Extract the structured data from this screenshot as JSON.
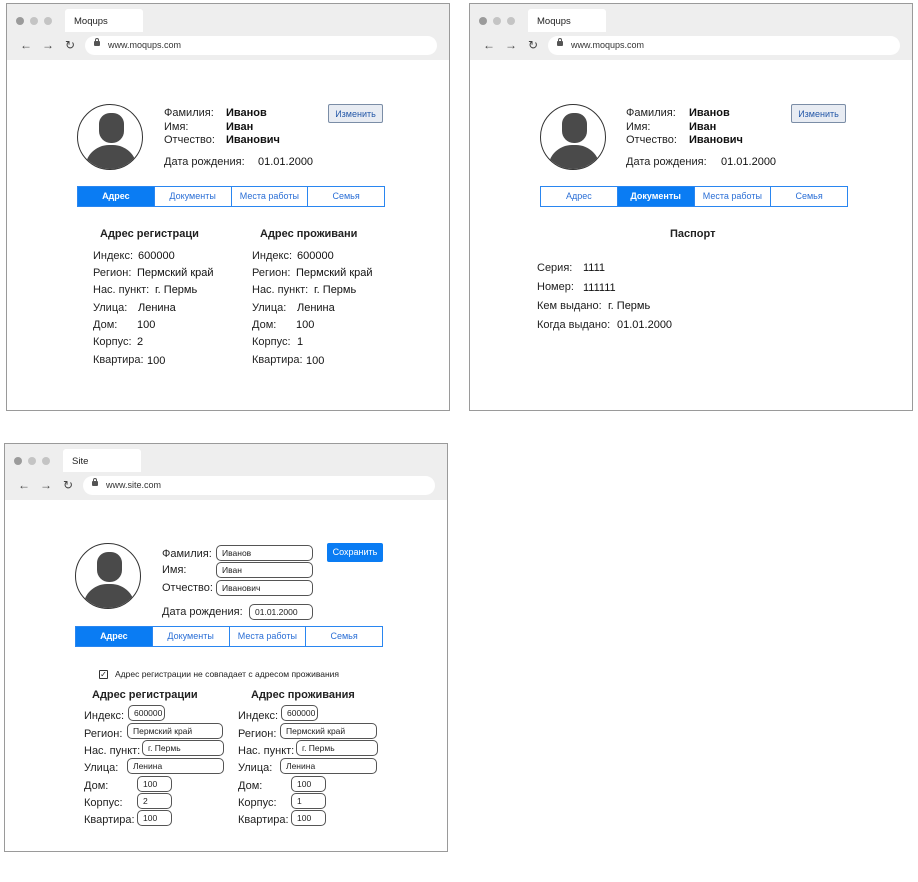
{
  "windows": [
    {
      "tab_title": "Moqups",
      "url": "www.moqups.com"
    },
    {
      "tab_title": "Moqups",
      "url": "www.moqups.com"
    },
    {
      "tab_title": "Site",
      "url": "www.site.com"
    }
  ],
  "nav": {
    "back": "←",
    "forward": "→",
    "reload": "↻"
  },
  "profile": {
    "surname_label": "Фамилия:",
    "surname": "Иванов",
    "name_label": "Имя:",
    "name": "Иван",
    "patronymic_label": "Отчество:",
    "patronymic": "Иванович",
    "birth_label": "Дата рождения:",
    "birth": "01.01.2000"
  },
  "buttons": {
    "edit": "Изменить",
    "save": "Сохранить"
  },
  "tabs": [
    "Адрес",
    "Документы",
    "Места работы",
    "Семья"
  ],
  "address": {
    "reg_title_cut": "Адрес регистраци",
    "live_title_cut": "Адрес проживани",
    "reg_title": "Адрес регистрации",
    "live_title": "Адрес проживания",
    "labels": {
      "index": "Индекс:",
      "region": "Регион:",
      "locality": "Нас. пункт:",
      "street": "Улица:",
      "house": "Дом:",
      "building": "Корпус:",
      "flat": "Квартира:"
    },
    "registration": {
      "index": "600000",
      "region": "Пермский край",
      "locality": "г. Пермь",
      "street": "Ленина",
      "house": "100",
      "building": "2",
      "flat": "100"
    },
    "residence": {
      "index": "600000",
      "region": "Пермский край",
      "locality": "г. Пермь",
      "street": "Ленина",
      "house": "100",
      "building": "1",
      "flat": "100"
    },
    "checkbox_label": "Адрес регистрации не совпадает с адресом проживания",
    "checkbox_mark": "✓"
  },
  "passport": {
    "title": "Паспорт",
    "series_label": "Серия:",
    "series": "1111",
    "number_label": "Номер:",
    "number": "111111",
    "issued_by_label": "Кем выдано:",
    "issued_by": "г. Пермь",
    "issued_date_label": "Когда выдано:",
    "issued_date": "01.01.2000"
  },
  "colors": {
    "accent": "#0a7cf3",
    "chrome": "#eeeeee",
    "avatar": "#4a4a4a"
  }
}
